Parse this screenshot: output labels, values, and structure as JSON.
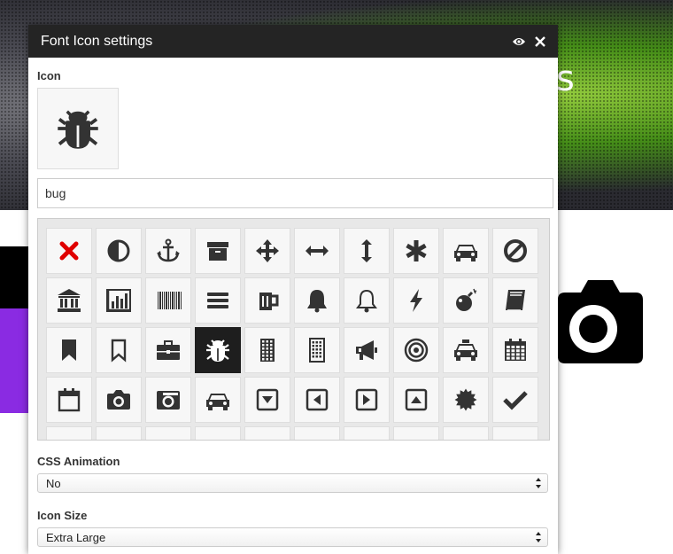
{
  "background": {
    "hero_text": "s"
  },
  "dialog": {
    "title": "Font Icon settings",
    "preview_icon_toggle": "eye-icon",
    "close_icon": "close-icon",
    "icon_label": "Icon",
    "selected_icon": "bug",
    "search_value": "bug",
    "icons": [
      "times",
      "adjust",
      "anchor",
      "archive",
      "arrows",
      "arrows-h",
      "arrows-v",
      "asterisk",
      "car",
      "ban",
      "bank",
      "bar-chart",
      "barcode",
      "bars",
      "beer",
      "bell",
      "bell-o",
      "bolt",
      "bomb",
      "book",
      "bookmark",
      "bookmark-o",
      "briefcase",
      "bug",
      "building",
      "building-o",
      "bullhorn",
      "bullseye",
      "cab",
      "calendar",
      "calendar-o",
      "camera",
      "camera-retro",
      "car",
      "caret-square-o-down",
      "caret-square-o-left",
      "caret-square-o-right",
      "caret-square-o-up",
      "certificate",
      "check"
    ],
    "css_animation": {
      "label": "CSS Animation",
      "value": "No"
    },
    "icon_size": {
      "label": "Icon Size",
      "value": "Extra Large"
    },
    "colors": {
      "header_bg": "#242424",
      "selected_bg": "#1e1e1e",
      "icon_color": "#333333",
      "times_red": "#e00000",
      "purple_accent": "#8a2be2"
    }
  }
}
